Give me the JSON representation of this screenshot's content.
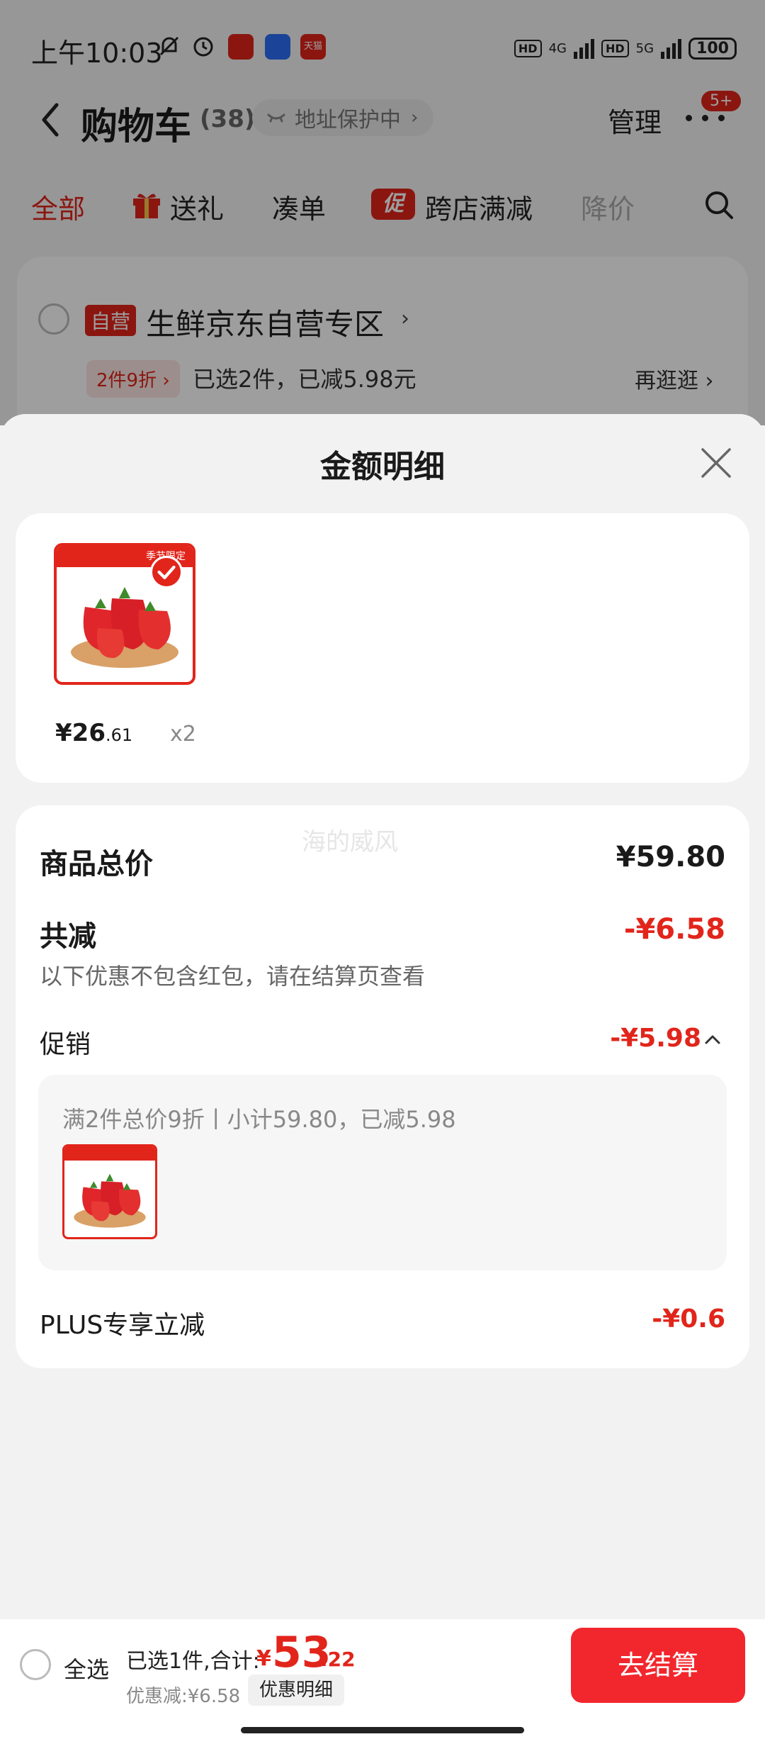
{
  "status_bar": {
    "time": "上午10:03",
    "network_1": "4G",
    "network_2": "5G",
    "hd": "HD",
    "battery": "100",
    "app_badge_tmall": "天猫"
  },
  "header": {
    "title": "购物车",
    "count": "(38)",
    "address_protection": "地址保护中",
    "address_chevron": "›",
    "manage": "管理",
    "badge": "5+"
  },
  "tabs": {
    "all": "全部",
    "gift": "送礼",
    "combine": "凑单",
    "promo_chip": "促",
    "cross_store": "跨店满减",
    "price_drop": "降价"
  },
  "store": {
    "badge": "自营",
    "name": "生鲜京东自营专区",
    "chevron": "›",
    "deal_tag": "2件9折 ›",
    "deal_text": "已选2件，已减5.98元",
    "go_shop": "再逛逛 ›"
  },
  "sheet": {
    "title": "金额明细",
    "item": {
      "thumb_label": "季节限定",
      "price_int": "¥26",
      "price_dec": ".61",
      "qty": "x2"
    },
    "watermark": "海的威风",
    "goods_total_label": "商品总价",
    "goods_total_value": "¥59.80",
    "discount_label": "共减",
    "discount_value": "-¥6.58",
    "note": "以下优惠不包含红包，请在结算页查看",
    "promo_label": "促销",
    "promo_value": "-¥5.98",
    "promo_rule": "满2件总价9折丨小计59.80，已减5.98",
    "plus_label": "PLUS专享立减",
    "plus_value": "-¥0.6"
  },
  "bottom_bar": {
    "select_all": "全选",
    "summary": "已选1件,合计:",
    "total_symbol": "¥",
    "total_int": "53",
    "total_dec": ".22",
    "saved": "优惠减:¥6.58",
    "detail_button": "优惠明细",
    "checkout": "去结算"
  },
  "colors": {
    "accent": "#e1251b",
    "checkout_bg": "#f2272d",
    "sheet_bg": "#f2f2f2"
  }
}
